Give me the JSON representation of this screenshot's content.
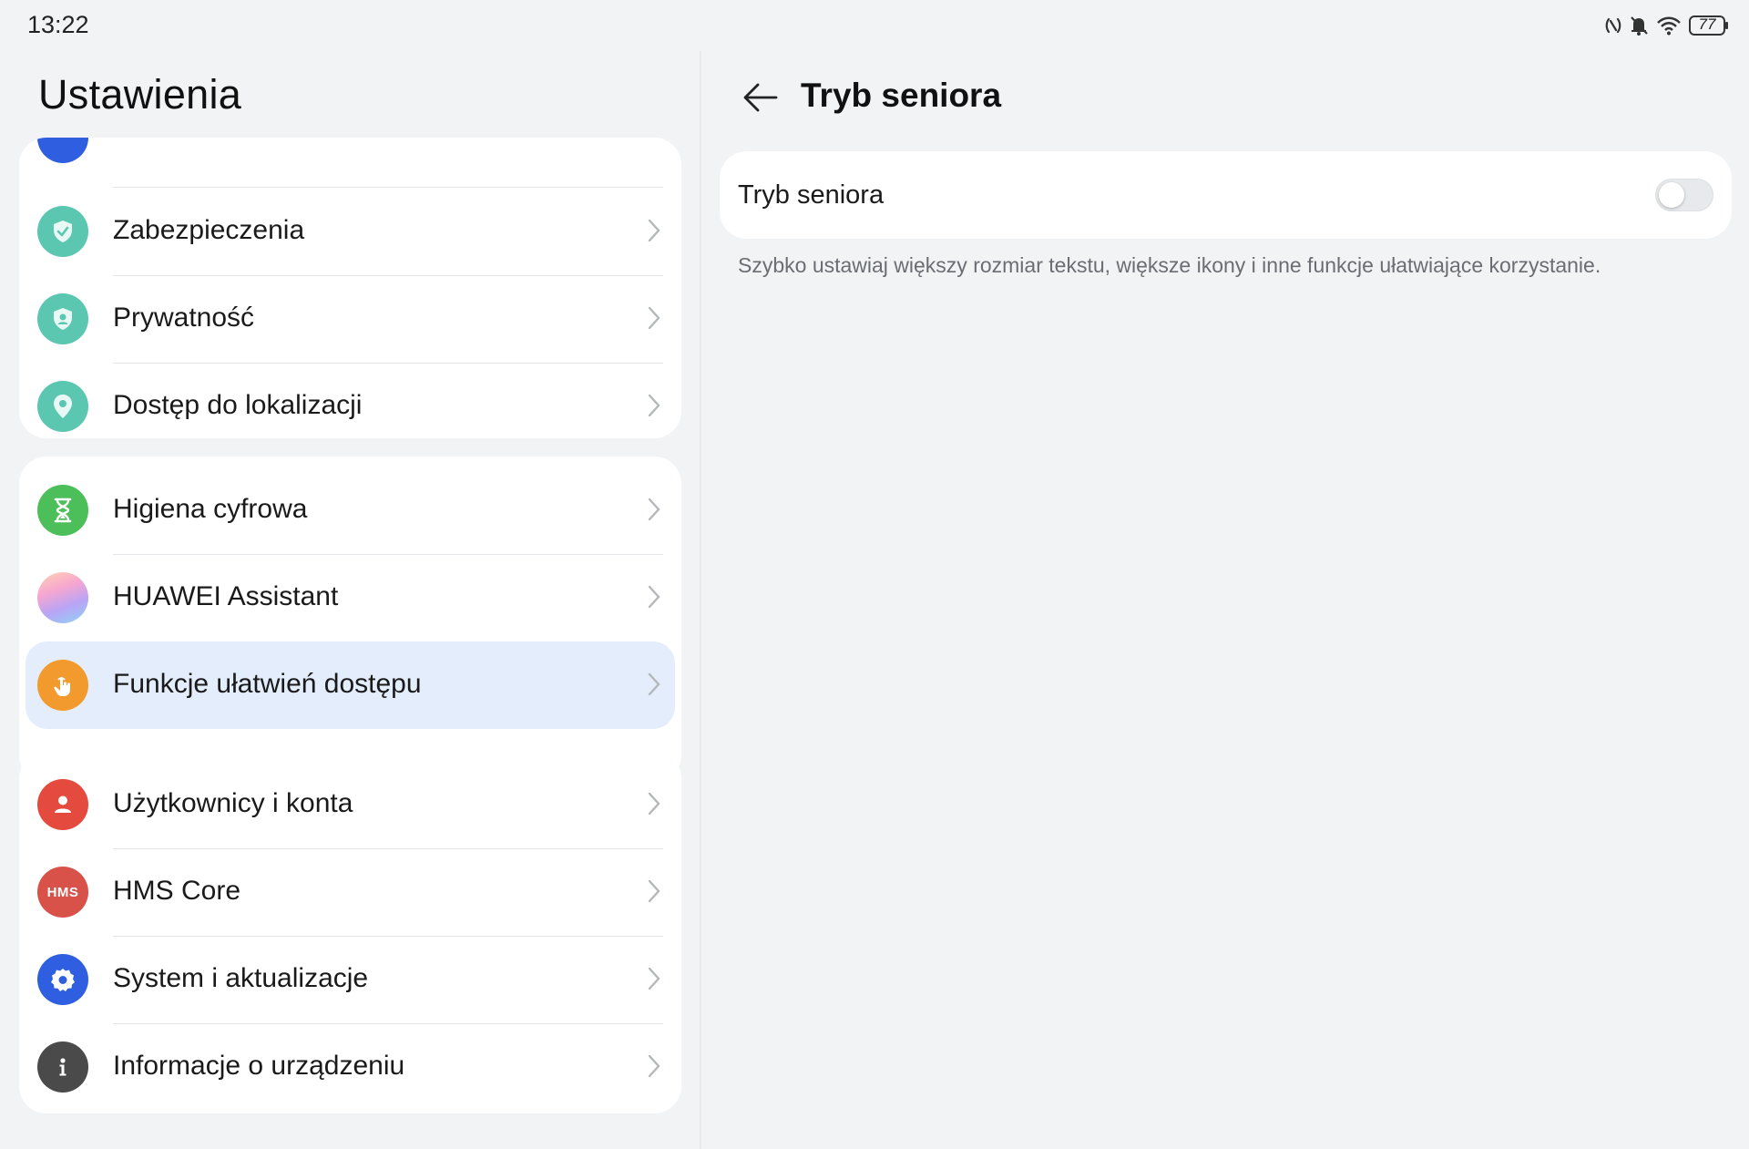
{
  "status_bar": {
    "time": "13:22",
    "battery": "77",
    "icons": [
      "nfc-icon",
      "bell-muted-icon",
      "wifi-icon",
      "battery-icon"
    ]
  },
  "left_panel": {
    "title": "Ustawienia",
    "groups": [
      {
        "items": [
          {
            "label": "Zabezpieczenia",
            "icon": "shield-check-icon",
            "color": "#5bc7b1"
          },
          {
            "label": "Prywatność",
            "icon": "privacy-shield-icon",
            "color": "#5bc7b1"
          },
          {
            "label": "Dostęp do lokalizacji",
            "icon": "location-pin-icon",
            "color": "#5bc7b1"
          }
        ]
      },
      {
        "items": [
          {
            "label": "Higiena cyfrowa",
            "icon": "hourglass-icon",
            "color": "#4cbf5a"
          },
          {
            "label": "HUAWEI Assistant",
            "icon": "assistant-gradient-icon",
            "color": "#c7a6f0"
          },
          {
            "label": "Funkcje ułatwień dostępu",
            "icon": "hand-tap-icon",
            "color": "#f29a2e",
            "selected": true
          }
        ]
      },
      {
        "items": [
          {
            "label": "Użytkownicy i konta",
            "icon": "user-icon",
            "color": "#e44a3d"
          },
          {
            "label": "HMS Core",
            "icon": "hms-icon",
            "color": "#d9524a",
            "icon_text": "HMS"
          },
          {
            "label": "System i aktualizacje",
            "icon": "gear-icon",
            "color": "#2f5fe0"
          },
          {
            "label": "Informacje o urządzeniu",
            "icon": "info-icon",
            "color": "#4a4a4a"
          }
        ]
      }
    ]
  },
  "right_panel": {
    "title": "Tryb seniora",
    "toggle": {
      "label": "Tryb seniora",
      "enabled": false
    },
    "description": "Szybko ustawiaj większy rozmiar tekstu, większe ikony i inne funkcje ułatwiające korzystanie."
  },
  "colors": {
    "background": "#f1f3f5",
    "card": "#ffffff",
    "selected_row": "#e3edfc",
    "accent": "#2f5fe0"
  }
}
